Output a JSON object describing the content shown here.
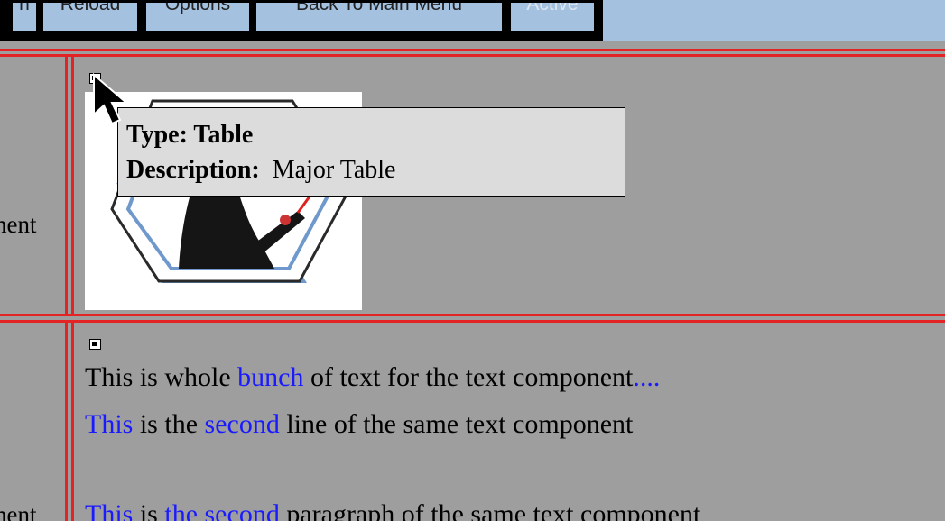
{
  "toolbar": {
    "partial_label": "n",
    "reload_label": "Reload",
    "options_label": "Options",
    "back_label": "Back To Main Menu",
    "active_label": "Active"
  },
  "rows": {
    "first_label_partial": "nent",
    "second_label_partial": "nent"
  },
  "tooltip": {
    "type_label": "Type:",
    "type_value": "Table",
    "description_label": "Description:",
    "description_value": "Major Table"
  },
  "text_component": {
    "line1": {
      "a": "This is whole ",
      "link1": "bunch",
      "b": " of text for the text component",
      "link2": "...."
    },
    "line2": {
      "link1": "This",
      "a": " is the ",
      "link2": "second",
      "b": " line of the same text component"
    },
    "line3": {
      "link1": "This",
      "a": " is ",
      "link2": "the second",
      "b": " paragraph of the same text component"
    }
  },
  "colors": {
    "toolbar_bg": "#a4c2e0",
    "content_bg": "#9e9e9e",
    "border_red": "#e42424",
    "link_blue": "#1a1aff",
    "tooltip_bg": "#dcdcdc"
  },
  "icons": [
    "component-marker-icon",
    "presenter-picture",
    "mouse-pointer-icon"
  ]
}
